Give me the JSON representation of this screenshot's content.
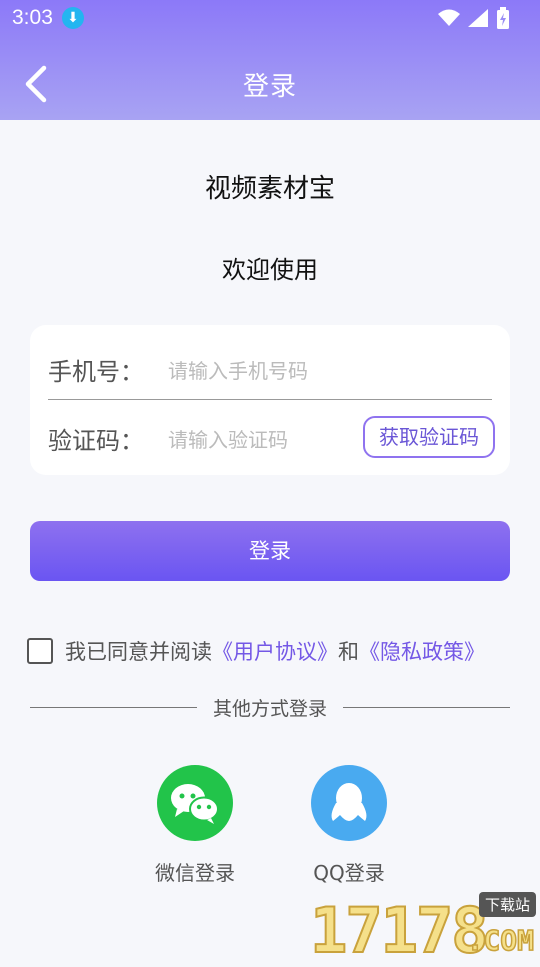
{
  "status": {
    "time": "3:03"
  },
  "nav": {
    "title": "登录"
  },
  "app": {
    "name": "视频素材宝",
    "welcome": "欢迎使用"
  },
  "form": {
    "phone_label": "手机号：",
    "phone_placeholder": "请输入手机号码",
    "code_label": "验证码：",
    "code_placeholder": "请输入验证码",
    "get_code_button": "获取验证码"
  },
  "login_button": "登录",
  "agreement": {
    "text": "我已同意并阅读",
    "user_agreement": "《用户协议》",
    "and": "和",
    "privacy_policy": "《隐私政策》"
  },
  "other_login": {
    "title": "其他方式登录",
    "wechat_label": "微信登录",
    "qq_label": "QQ登录"
  },
  "watermark": {
    "number": "17178",
    "tag": "下载站",
    "domain": ".COM"
  },
  "colors": {
    "accent": "#7458e6",
    "wechat": "#22c44a",
    "qq": "#49aaf0",
    "header": "#8c79f8"
  },
  "icons": [
    "download-icon",
    "wifi-icon",
    "signal-icon",
    "battery-icon",
    "back-arrow-icon",
    "wechat-icon",
    "qq-icon"
  ]
}
